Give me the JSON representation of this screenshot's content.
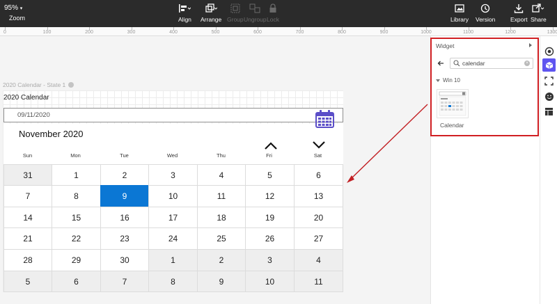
{
  "toolbar": {
    "zoom_value": "95%",
    "zoom_label": "Zoom",
    "align_label": "Align",
    "arrange_label": "Arrange",
    "group_label": "Group",
    "ungroup_label": "Ungroup",
    "lock_label": "Lock",
    "library_label": "Library",
    "version_label": "Version",
    "export_label": "Export",
    "share_label": "Share"
  },
  "ruler": [
    "0",
    "100",
    "200",
    "300",
    "400",
    "500",
    "600",
    "700",
    "800",
    "900",
    "1000",
    "1100",
    "1200",
    "1300"
  ],
  "canvas": {
    "state_label": "2020 Calendar - State 1",
    "widget_title": "2020 Calendar",
    "date_value": "09/11/2020",
    "month_label": "November 2020",
    "weekdays": [
      "Sun",
      "Mon",
      "Tue",
      "Wed",
      "Thu",
      "Fri",
      "Sat"
    ],
    "weeks": [
      [
        "31",
        "1",
        "2",
        "3",
        "4",
        "5",
        "6"
      ],
      [
        "7",
        "8",
        "9",
        "10",
        "11",
        "12",
        "13"
      ],
      [
        "14",
        "15",
        "16",
        "17",
        "18",
        "19",
        "20"
      ],
      [
        "21",
        "22",
        "23",
        "24",
        "25",
        "26",
        "27"
      ],
      [
        "28",
        "29",
        "30",
        "1",
        "2",
        "3",
        "4"
      ],
      [
        "5",
        "6",
        "7",
        "8",
        "9",
        "10",
        "11"
      ]
    ],
    "selected_day": "9",
    "selected_color": "#0b77d4",
    "icon_color": "#5b4ec8"
  },
  "widget_panel": {
    "title": "Widget",
    "search_value": "calendar",
    "group_label": "Win 10",
    "item_label": "Calendar",
    "highlight_color": "#d01f23"
  },
  "side_icons": [
    "target-icon",
    "widget-cube-icon",
    "resize-icon",
    "emoji-icon",
    "table-icon"
  ]
}
